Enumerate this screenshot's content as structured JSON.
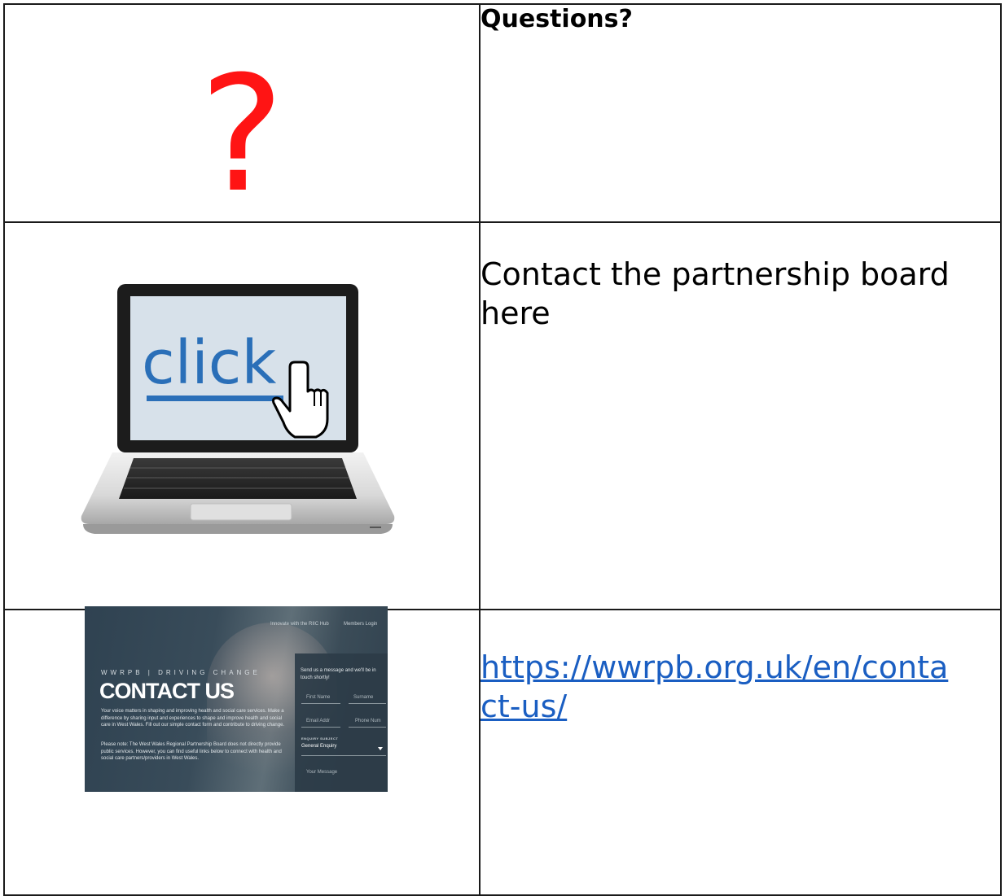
{
  "rows": [
    {
      "icon": "question-mark-icon",
      "icon_text": "?",
      "icon_color": "#ff1414",
      "text": "Questions?"
    },
    {
      "icon": "laptop-click-icon",
      "screen_text": "click",
      "text": "Contact the partnership board here"
    },
    {
      "icon": "website-screenshot",
      "link": "https://wwrpb.org.uk/en/contact-us/"
    }
  ],
  "website_preview": {
    "nav": [
      "Innovate with the RIIC Hub",
      "Members Login"
    ],
    "brand": "WWRPB | DRIVING CHANGE",
    "title": "CONTACT US",
    "para1": "Your voice matters in shaping and improving health and social care services. Make a difference by sharing input and experiences to shape and improve health and social care in West Wales. Fill out our simple contact form and contribute to driving change.",
    "para2": "Please note: The West Wales Regional Partnership Board does not directly provide public services. However, you can find useful links below to connect with health and social care partners/providers in West Wales.",
    "form_intro": "Send us a message and we'll be in touch shortly!",
    "fields": [
      "First Name",
      "Surname",
      "Email Addr",
      "Phone Num"
    ],
    "subject_label": "ENQUIRY SUBJECT",
    "subject_value": "General Enquiry",
    "message_placeholder": "Your Message"
  },
  "colors": {
    "link": "#1a5ec2",
    "border": "#1a1a1a",
    "preview_bg": "#33495a"
  }
}
